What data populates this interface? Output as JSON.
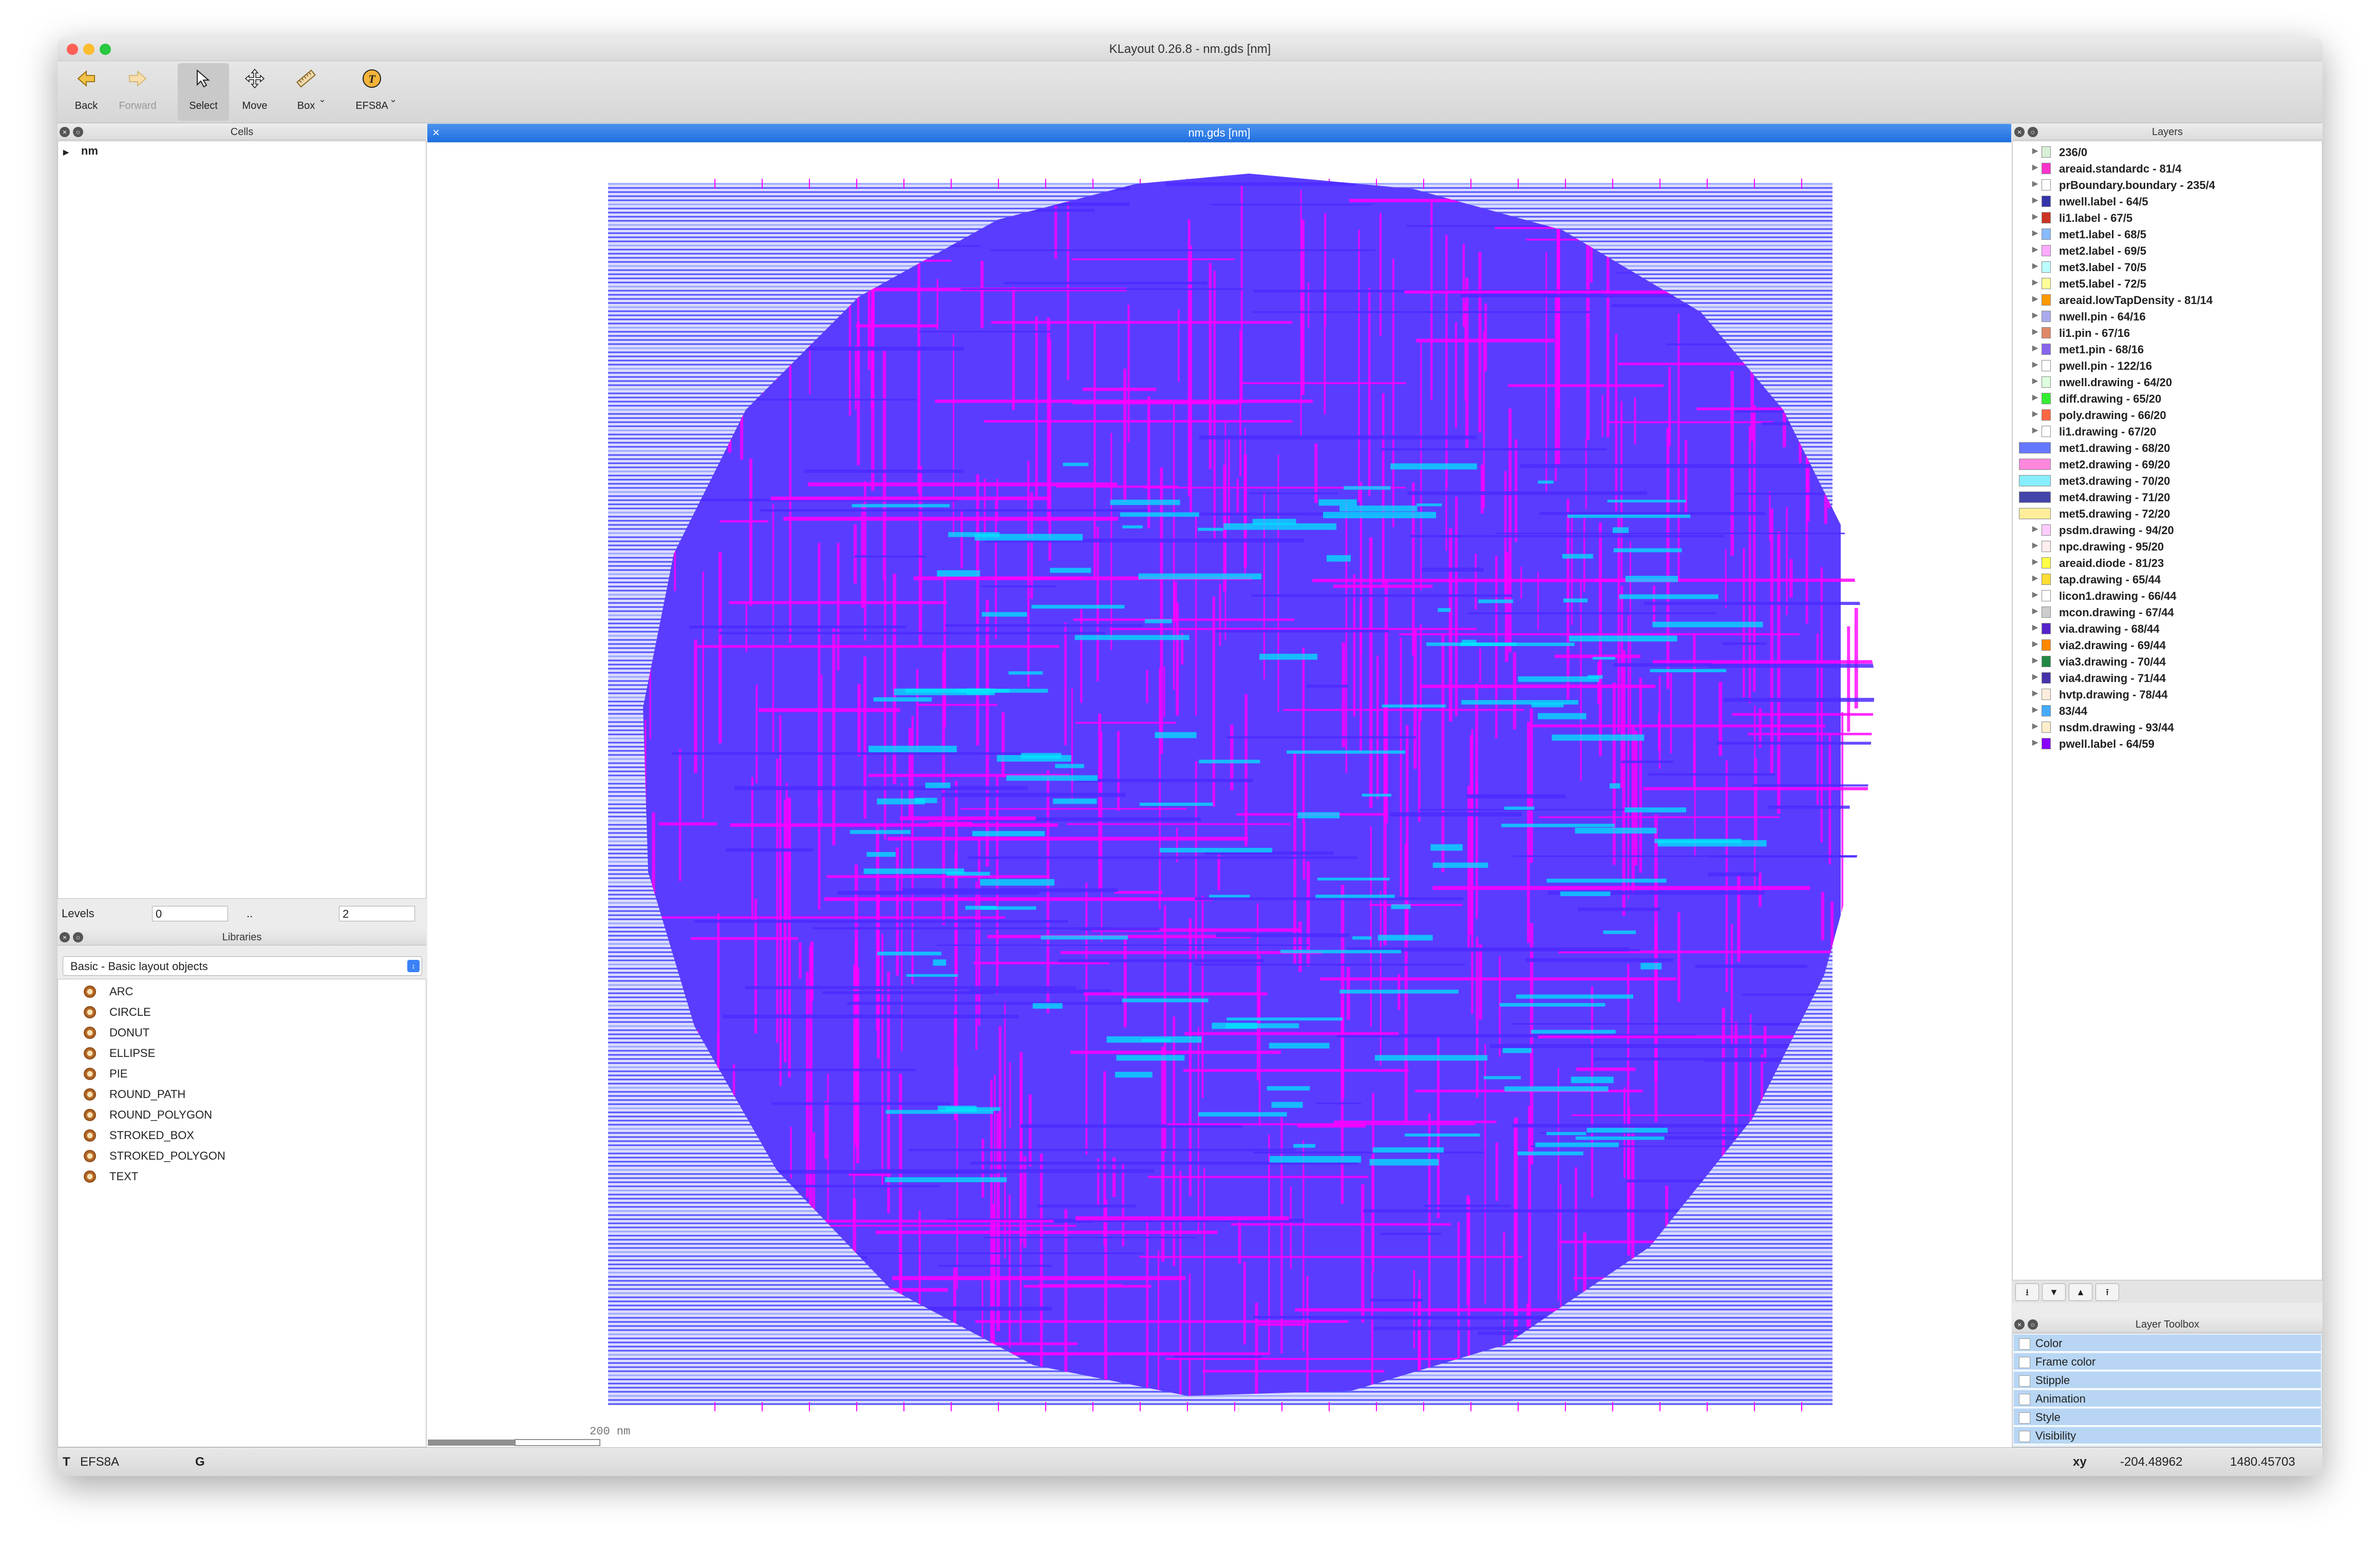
{
  "window": {
    "title": "KLayout 0.26.8 - nm.gds [nm]"
  },
  "toolbar": {
    "back": "Back",
    "forward": "Forward",
    "select": "Select",
    "move": "Move",
    "box": "Box",
    "tech": "EFS8A"
  },
  "cells": {
    "title": "Cells",
    "root": "nm",
    "levels_label": "Levels",
    "levels_from": "0",
    "levels_sep": "..",
    "levels_to": "2"
  },
  "libraries": {
    "title": "Libraries",
    "selected": "Basic - Basic layout objects",
    "items": [
      "ARC",
      "CIRCLE",
      "DONUT",
      "ELLIPSE",
      "PIE",
      "ROUND_PATH",
      "ROUND_POLYGON",
      "STROKED_BOX",
      "STROKED_POLYGON",
      "TEXT"
    ]
  },
  "view": {
    "tab_title": "nm.gds [nm]",
    "scale_label": "200 nm"
  },
  "layers": {
    "title": "Layers",
    "items": [
      {
        "name": "236/0",
        "color": "#d8f0d8"
      },
      {
        "name": "areaid.standardc - 81/4",
        "color": "#ff33cc"
      },
      {
        "name": "prBoundary.boundary - 235/4",
        "color": "#ffffff"
      },
      {
        "name": "nwell.label - 64/5",
        "color": "#3333aa"
      },
      {
        "name": "li1.label - 67/5",
        "color": "#cc3322"
      },
      {
        "name": "met1.label - 68/5",
        "color": "#88bbff"
      },
      {
        "name": "met2.label - 69/5",
        "color": "#ffaaff"
      },
      {
        "name": "met3.label - 70/5",
        "color": "#bbffff"
      },
      {
        "name": "met5.label - 72/5",
        "color": "#ffff99"
      },
      {
        "name": "areaid.lowTapDensity - 81/14",
        "color": "#ff9900"
      },
      {
        "name": "nwell.pin - 64/16",
        "color": "#aaaaee"
      },
      {
        "name": "li1.pin - 67/16",
        "color": "#dd8866"
      },
      {
        "name": "met1.pin - 68/16",
        "color": "#8866ee"
      },
      {
        "name": "pwell.pin - 122/16",
        "color": "#ffffff"
      },
      {
        "name": "nwell.drawing - 64/20",
        "color": "#ddffdd"
      },
      {
        "name": "diff.drawing - 65/20",
        "color": "#33ee33"
      },
      {
        "name": "poly.drawing - 66/20",
        "color": "#ff6644"
      },
      {
        "name": "li1.drawing - 67/20",
        "color": "#ffffff"
      },
      {
        "name": "met1.drawing - 68/20",
        "color": "#6677ff"
      },
      {
        "name": "met2.drawing - 69/20",
        "color": "#ff88dd"
      },
      {
        "name": "met3.drawing - 70/20",
        "color": "#88eeff"
      },
      {
        "name": "met4.drawing - 71/20",
        "color": "#4444aa"
      },
      {
        "name": "met5.drawing - 72/20",
        "color": "#ffee99"
      },
      {
        "name": "psdm.drawing - 94/20",
        "color": "#ffccff"
      },
      {
        "name": "npc.drawing - 95/20",
        "color": "#ffeeee"
      },
      {
        "name": "areaid.diode - 81/23",
        "color": "#ffff44"
      },
      {
        "name": "tap.drawing - 65/44",
        "color": "#ffdd33"
      },
      {
        "name": "licon1.drawing - 66/44",
        "color": "#ffffff"
      },
      {
        "name": "mcon.drawing - 67/44",
        "color": "#cccccc"
      },
      {
        "name": "via.drawing - 68/44",
        "color": "#5522cc"
      },
      {
        "name": "via2.drawing - 69/44",
        "color": "#ff8800"
      },
      {
        "name": "via3.drawing - 70/44",
        "color": "#228844"
      },
      {
        "name": "via4.drawing - 71/44",
        "color": "#4433aa"
      },
      {
        "name": "hvtp.drawing - 78/44",
        "color": "#ffeedd"
      },
      {
        "name": "83/44",
        "color": "#44aaff"
      },
      {
        "name": "nsdm.drawing - 93/44",
        "color": "#ffeecc"
      },
      {
        "name": "pwell.label - 64/59",
        "color": "#8800ff"
      }
    ]
  },
  "toolbox": {
    "title": "Layer Toolbox",
    "items": [
      "Color",
      "Frame color",
      "Stipple",
      "Animation",
      "Style",
      "Visibility"
    ]
  },
  "status": {
    "mode": "T",
    "tech": "EFS8A",
    "grid": "G",
    "coord_label": "xy",
    "x": "-204.48962",
    "y": "1480.45703"
  },
  "colors": {
    "layout_blue": "#3a3aff",
    "layout_magenta": "#ff00ff",
    "layout_cyan": "#00e5ff",
    "selection_blue": "#1f6fe0"
  }
}
